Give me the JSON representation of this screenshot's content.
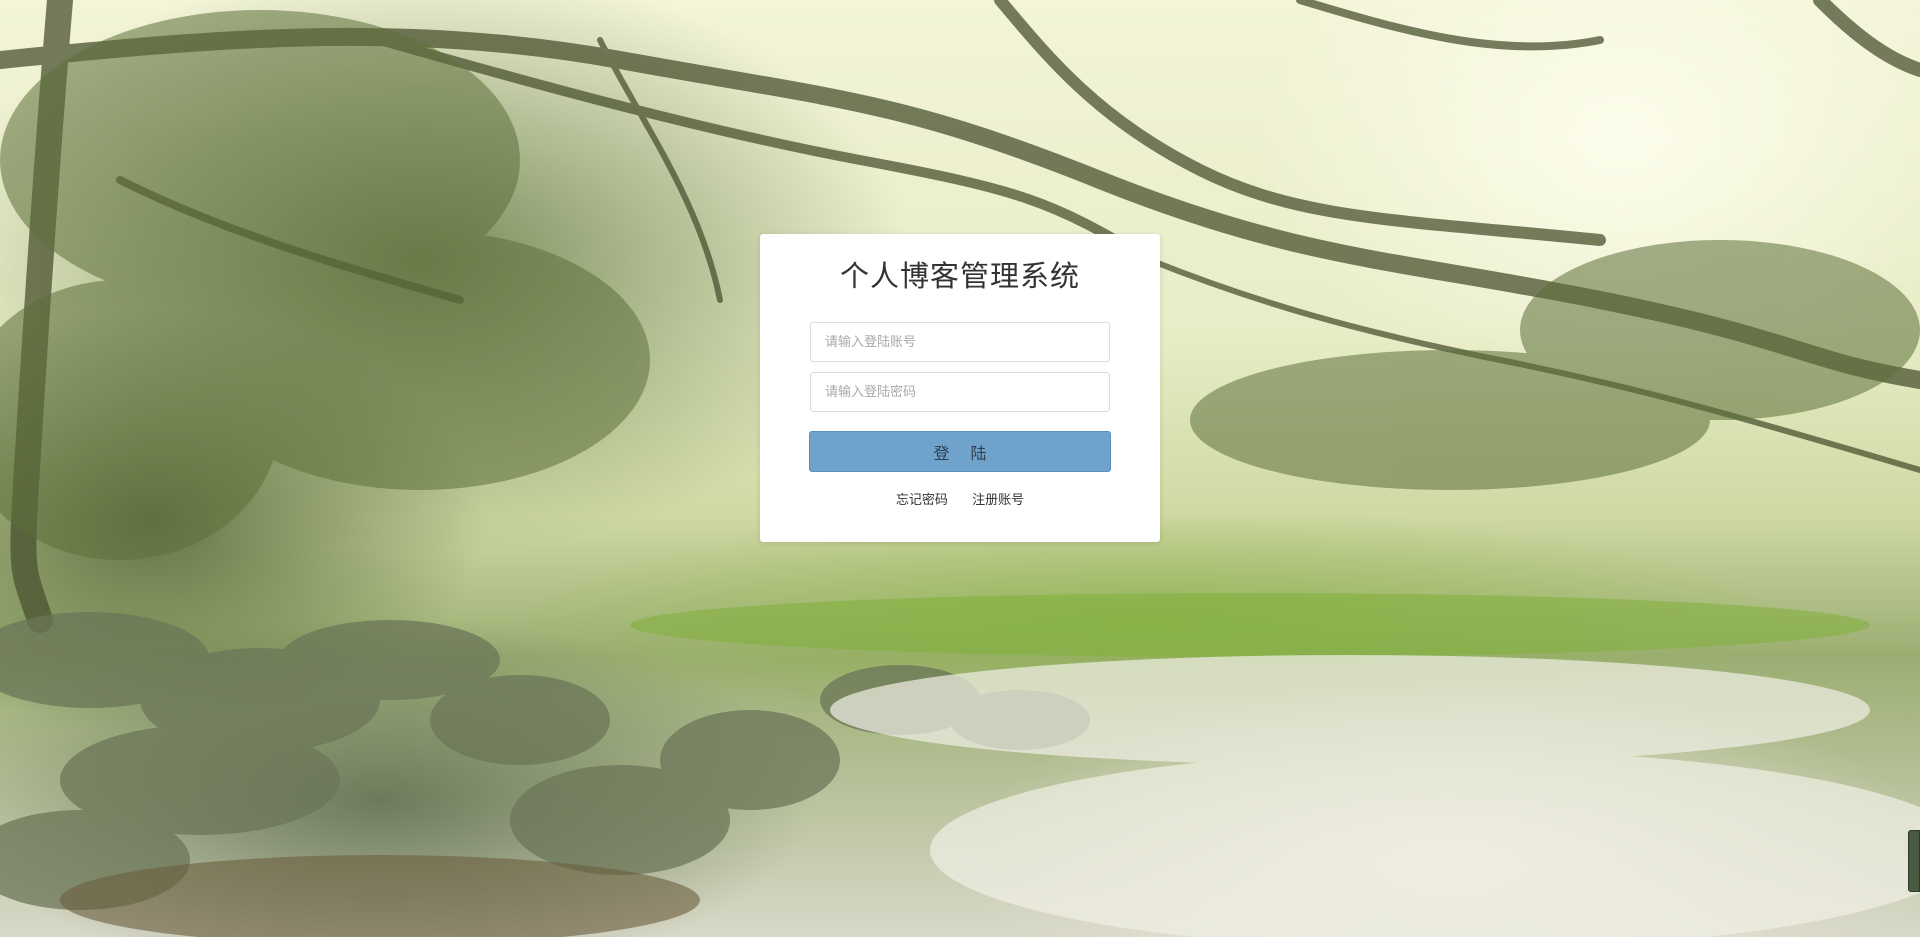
{
  "login": {
    "title": "个人博客管理系统",
    "account_placeholder": "请输入登陆账号",
    "password_placeholder": "请输入登陆密码",
    "submit_label": "登 陆",
    "forgot_password": "忘记密码",
    "register": "注册账号"
  },
  "colors": {
    "button_bg": "#6fa3cc",
    "panel_bg": "#ffffff",
    "title_text": "#333333"
  }
}
